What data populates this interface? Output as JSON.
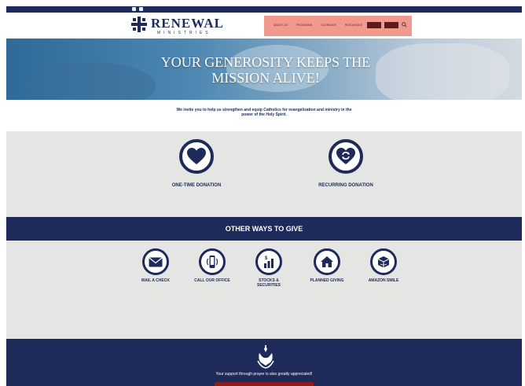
{
  "topbar": {
    "social_icons": [
      "facebook-icon",
      "youtube-icon"
    ],
    "links": [
      "",
      "",
      ""
    ]
  },
  "header": {
    "brand": "RENEWAL",
    "brand_sub": "MINISTRIES",
    "nav": [
      "ABOUT US",
      "PROGRAMS",
      "OUTREACH",
      "RESOURCES"
    ],
    "buttons": [
      "",
      ""
    ],
    "highlight_color": "#f08e81"
  },
  "hero": {
    "title": "YOUR GENEROSITY KEEPS THE MISSION ALIVE!"
  },
  "intro": {
    "main": "We invite you to help us strengthen and equip Catholics for evangelization and ministry in the power of the Holy Spirit.",
    "sub": ""
  },
  "donations": [
    {
      "icon": "heart-icon",
      "title": "ONE-TIME DONATION",
      "text": ""
    },
    {
      "icon": "recurring-heart-icon",
      "title": "RECURRING DONATION",
      "text": ""
    }
  ],
  "other_ways": {
    "heading": "OTHER WAYS TO GIVE",
    "items": [
      {
        "icon": "envelope-icon",
        "title": "MAIL A CHECK",
        "text": ""
      },
      {
        "icon": "phone-icon",
        "title": "CALL OUR OFFICE",
        "text": ""
      },
      {
        "icon": "chart-icon",
        "title": "STOCKS & SECURITIES",
        "text": ""
      },
      {
        "icon": "house-icon",
        "title": "PLANNED GIVING",
        "text": ""
      },
      {
        "icon": "box-icon",
        "title": "AMAZON SMILE",
        "text": ""
      }
    ]
  },
  "footer": {
    "icon": "praying-hands-icon",
    "text": "Your support through prayer is also greatly appreciated!"
  },
  "colors": {
    "navy": "#1e2b5a",
    "panel_gray": "#e5e5e3",
    "accent_red": "#8a1e1e"
  }
}
